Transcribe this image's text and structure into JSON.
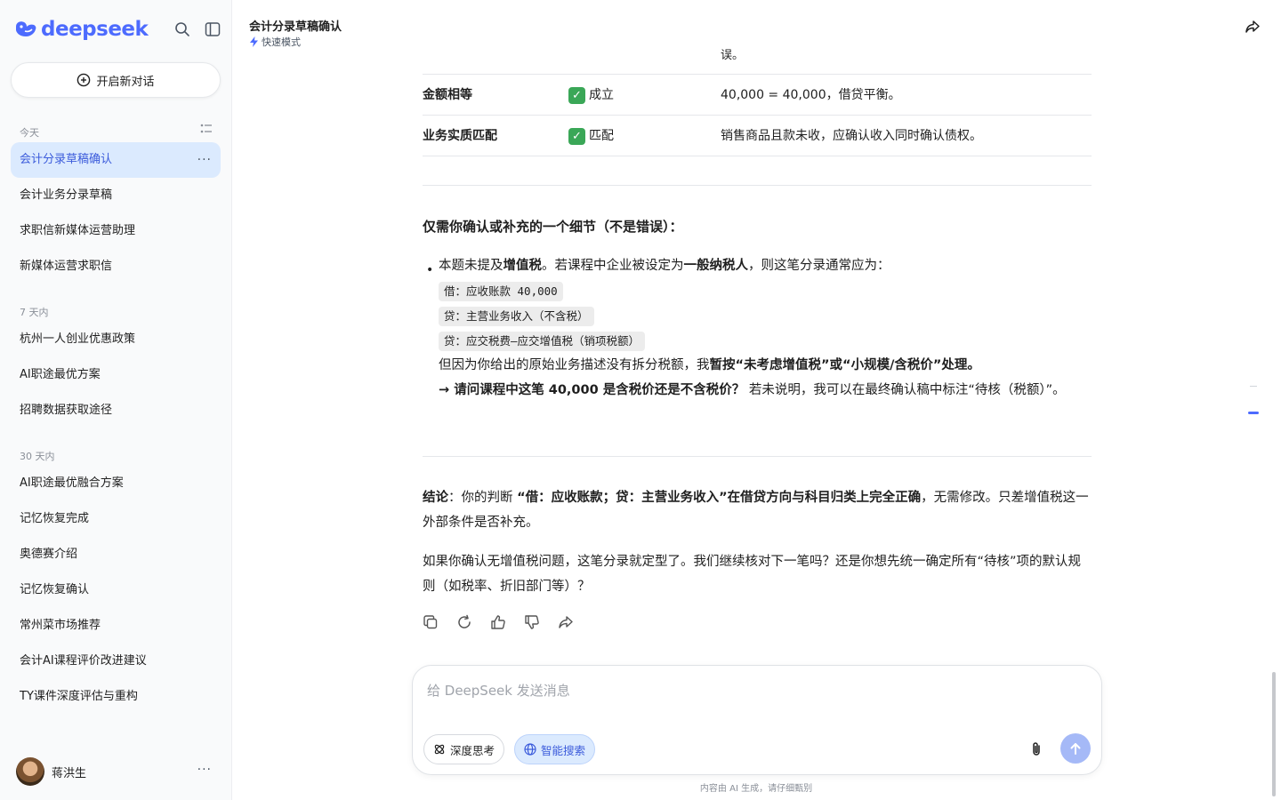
{
  "sidebar": {
    "logo_text": "deepseek",
    "new_chat_label": "开启新对话",
    "sections": [
      {
        "heading": "今天",
        "items": [
          "会计分录草稿确认",
          "会计业务分录草稿",
          "求职信新媒体运营助理",
          "新媒体运营求职信"
        ]
      },
      {
        "heading": "7 天内",
        "items": [
          "杭州一人创业优惠政策",
          "AI职途最优方案",
          "招聘数据获取途径"
        ]
      },
      {
        "heading": "30 天内",
        "items": [
          "AI职途最优融合方案",
          "记忆恢复完成",
          "奥德赛介绍",
          "记忆恢复确认",
          "常州菜市场推荐",
          "会计AI课程评价改进建议",
          "TY课件深度评估与重构"
        ]
      }
    ],
    "more_glyph": "···",
    "user": {
      "name": "蒋洪生"
    }
  },
  "header": {
    "title": "会计分录草稿确认",
    "mode": "快速模式"
  },
  "message": {
    "fragment_top": "误。",
    "table_rows": [
      {
        "item": "金额相等",
        "status": "成立",
        "note": "40,000 = 40,000，借贷平衡。"
      },
      {
        "item": "业务实质匹配",
        "status": "匹配",
        "note": "销售商品且款未收，应确认收入同时确认债权。"
      }
    ],
    "check_glyph": "✓",
    "detail_heading": "仅需你确认或补充的一个细节（不是错误）：",
    "bullet_glyph": "•",
    "bullet": {
      "s1": "本题未提及",
      "b1": "增值税",
      "s2": "。若课程中企业被设定为",
      "b2": "一般纳税人",
      "s3": "，则这笔分录通常应为："
    },
    "entries": [
      "借：应收账款 40,000",
      "贷：主营业务收入（不含税）",
      "贷：应交税费–应交增值税（销项税额）"
    ],
    "reason": {
      "s1": "但因为你给出的原始业务描述没有拆分税额，我",
      "b1": "暂按“未考虑增值税”或“小规模/含税价”处理。"
    },
    "question": {
      "b1": "→ 请问课程中这笔 40,000 是含税价还是不含税价？",
      "s1": " 若未说明，我可以在最终确认稿中标注“待核（税额）”。"
    },
    "conclusion": {
      "b1": "结论",
      "s1": "：你的判断 ",
      "b2": "“借：应收账款；贷：主营业务收入”在借贷方向与科目归类上完全正确",
      "s2": "，无需修改。只差增值税这一外部条件是否补充。"
    },
    "followup": "如果你确认无增值税问题，这笔分录就定型了。我们继续核对下一笔吗？还是你想先统一确定所有“待核”项的默认规则（如税率、折旧部门等）？"
  },
  "composer": {
    "placeholder": "给 DeepSeek 发送消息",
    "deep_think_label": "深度思考",
    "search_label": "智能搜索"
  },
  "disclaimer": "内容由 AI 生成，请仔细甄别",
  "colors": {
    "accent": "#4d6bfe",
    "active_bg": "#dbeafe",
    "check_green": "#3aa757"
  }
}
